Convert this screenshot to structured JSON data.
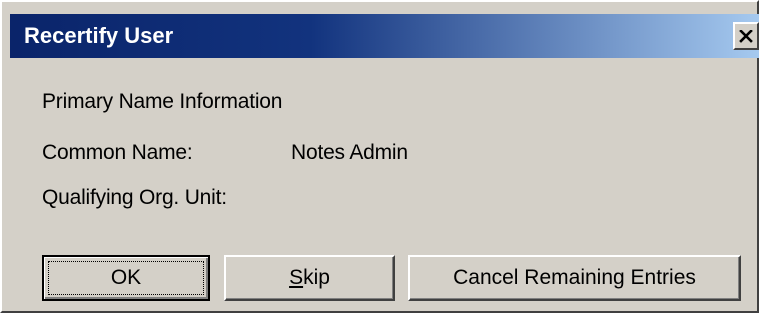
{
  "window": {
    "title": "Recertify User",
    "close_icon": "close-icon"
  },
  "section": {
    "heading": "Primary Name Information"
  },
  "fields": {
    "common_name_label": "Common Name:",
    "common_name_value": "Notes Admin",
    "org_unit_label": "Qualifying Org. Unit:",
    "org_unit_value": ""
  },
  "buttons": {
    "ok_label": "OK",
    "skip_mnemonic": "S",
    "skip_rest": "kip",
    "cancel_label": "Cancel Remaining Entries"
  },
  "colors": {
    "title_bar_start": "#0a246a",
    "title_bar_end": "#a6caf0",
    "dialog_face": "#d4d0c8"
  }
}
